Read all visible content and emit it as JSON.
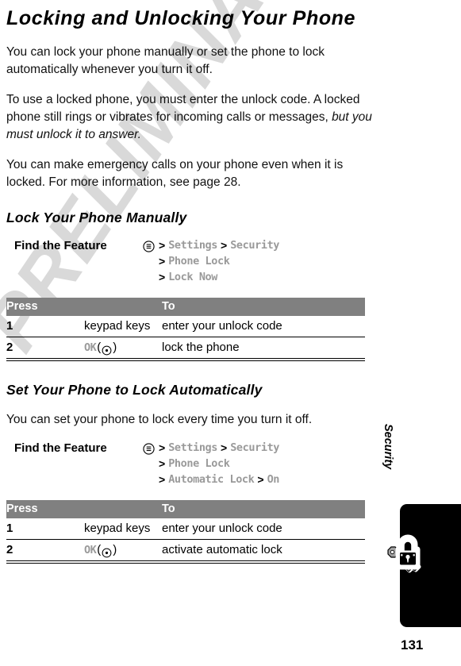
{
  "document": {
    "title": "Locking and Unlocking Your Phone",
    "page_number": "131",
    "chapter_label": "Security",
    "watermark": "PRELIMINARY",
    "chapter_icon": "padlock-and-key-icon"
  },
  "intro": {
    "para1": "You can lock your phone manually or set the phone to lock automatically whenever you turn it off.",
    "para2_before": "To use a locked phone, you must enter the unlock code. A locked phone still rings or vibrates for incoming calls or messages, ",
    "para2_italic": "but you must unlock it to answer.",
    "para3": "You can make emergency calls on your phone even when it is locked. For more information, see page 28."
  },
  "sections": [
    {
      "heading": "Lock Your Phone Manually",
      "body": "",
      "find_feature": {
        "label": "Find the Feature",
        "menu_icon": "menu-key-icon",
        "lines": [
          {
            "terms": [
              "Settings",
              "Security"
            ]
          },
          {
            "terms": [
              "Phone Lock"
            ]
          },
          {
            "terms": [
              "Lock Now"
            ]
          }
        ]
      },
      "table": {
        "headers": [
          "Press",
          "To"
        ],
        "rows": [
          {
            "num": "1",
            "press_text": "keypad keys",
            "press_key": null,
            "to": "enter your unlock code"
          },
          {
            "num": "2",
            "press_text": null,
            "press_key": "OK",
            "to": "lock the phone"
          }
        ]
      }
    },
    {
      "heading": "Set Your Phone to Lock Automatically",
      "body": "You can set your phone to lock every time you turn it off.",
      "find_feature": {
        "label": "Find the Feature",
        "menu_icon": "menu-key-icon",
        "lines": [
          {
            "terms": [
              "Settings",
              "Security"
            ]
          },
          {
            "terms": [
              "Phone Lock"
            ]
          },
          {
            "terms": [
              "Automatic Lock",
              "On"
            ]
          }
        ]
      },
      "table": {
        "headers": [
          "Press",
          "To"
        ],
        "rows": [
          {
            "num": "1",
            "press_text": "keypad keys",
            "press_key": null,
            "to": "enter your unlock code"
          },
          {
            "num": "2",
            "press_text": null,
            "press_key": "OK",
            "to": "activate automatic lock"
          }
        ]
      }
    }
  ],
  "symbols": {
    "chevron": ">",
    "paren_open": "(",
    "paren_close": ")"
  },
  "colors": {
    "table_header_bg": "#808080",
    "menu_term": "#9a9a9a",
    "watermark": "#d9d9d9",
    "text": "#000000"
  }
}
